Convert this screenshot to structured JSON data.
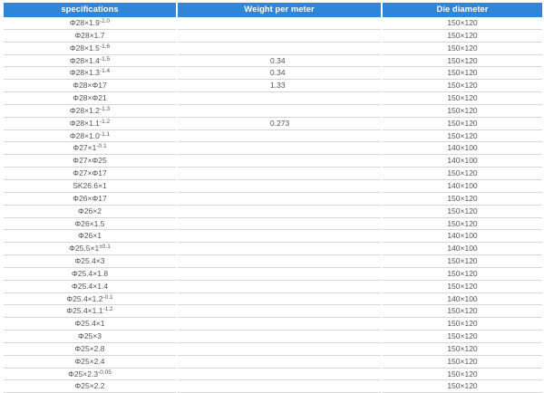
{
  "table": {
    "headers": [
      "specifications",
      "Weight per meter",
      "Die diameter"
    ],
    "rows": [
      {
        "spec": "Φ28×1.9",
        "sup": "-2.0",
        "weight": "",
        "die": "150×120"
      },
      {
        "spec": "Φ28×1.7",
        "sup": "",
        "weight": "",
        "die": "150×120"
      },
      {
        "spec": "Φ28×1.5",
        "sup": "-1.6",
        "weight": "",
        "die": "150×120"
      },
      {
        "spec": "Φ28×1.4",
        "sup": "-1.5",
        "weight": "0.34",
        "die": "150×120"
      },
      {
        "spec": "Φ28×1.3",
        "sup": "-1.4",
        "weight": "0.34",
        "die": "150×120"
      },
      {
        "spec": "Φ28×Φ17",
        "sup": "",
        "weight": "1.33",
        "die": "150×120"
      },
      {
        "spec": "Φ28×Φ21",
        "sup": "",
        "weight": "",
        "die": "150×120"
      },
      {
        "spec": "Φ28×1.2",
        "sup": "-1.3",
        "weight": "",
        "die": "150×120"
      },
      {
        "spec": "Φ28×1.1",
        "sup": "-1.2",
        "weight": "0.273",
        "die": "150×120"
      },
      {
        "spec": "Φ28×1.0",
        "sup": "-1.1",
        "weight": "",
        "die": "150×120"
      },
      {
        "spec": "Φ27×1",
        "sup": "-0.1",
        "weight": "",
        "die": "140×100"
      },
      {
        "spec": "Φ27×Φ25",
        "sup": "",
        "weight": "",
        "die": "140×100"
      },
      {
        "spec": "Φ27×Φ17",
        "sup": "",
        "weight": "",
        "die": "150×120"
      },
      {
        "spec": "SK26.6×1",
        "sup": "",
        "weight": "",
        "die": "140×100"
      },
      {
        "spec": "Φ26×Φ17",
        "sup": "",
        "weight": "",
        "die": "150×120"
      },
      {
        "spec": "Φ26×2",
        "sup": "",
        "weight": "",
        "die": "150×120"
      },
      {
        "spec": "Φ26×1.5",
        "sup": "",
        "weight": "",
        "die": "150×120"
      },
      {
        "spec": "Φ26×1",
        "sup": "",
        "weight": "",
        "die": "140×100"
      },
      {
        "spec": "Φ25.5×1",
        "sup": "±0.1",
        "weight": "",
        "die": "140×100"
      },
      {
        "spec": "Φ25.4×3",
        "sup": "",
        "weight": "",
        "die": "150×120"
      },
      {
        "spec": "Φ25.4×1.8",
        "sup": "",
        "weight": "",
        "die": "150×120"
      },
      {
        "spec": "Φ25.4×1.4",
        "sup": "",
        "weight": "",
        "die": "150×120"
      },
      {
        "spec": "Φ25.4×1.2",
        "sup": "-0.1",
        "weight": "",
        "die": "140×100"
      },
      {
        "spec": "Φ25.4×1.1",
        "sup": "-1.2",
        "weight": "",
        "die": "150×120"
      },
      {
        "spec": "Φ25.4×1",
        "sup": "",
        "weight": "",
        "die": "150×120"
      },
      {
        "spec": "Φ25×3",
        "sup": "",
        "weight": "",
        "die": "150×120"
      },
      {
        "spec": "Φ25×2.8",
        "sup": "",
        "weight": "",
        "die": "150×120"
      },
      {
        "spec": "Φ25×2.4",
        "sup": "",
        "weight": "",
        "die": "150×120"
      },
      {
        "spec": "Φ25×2.3",
        "sup": "-0.05",
        "weight": "",
        "die": "150×120"
      },
      {
        "spec": "Φ25×2.2",
        "sup": "",
        "weight": "",
        "die": "150×120"
      }
    ]
  }
}
